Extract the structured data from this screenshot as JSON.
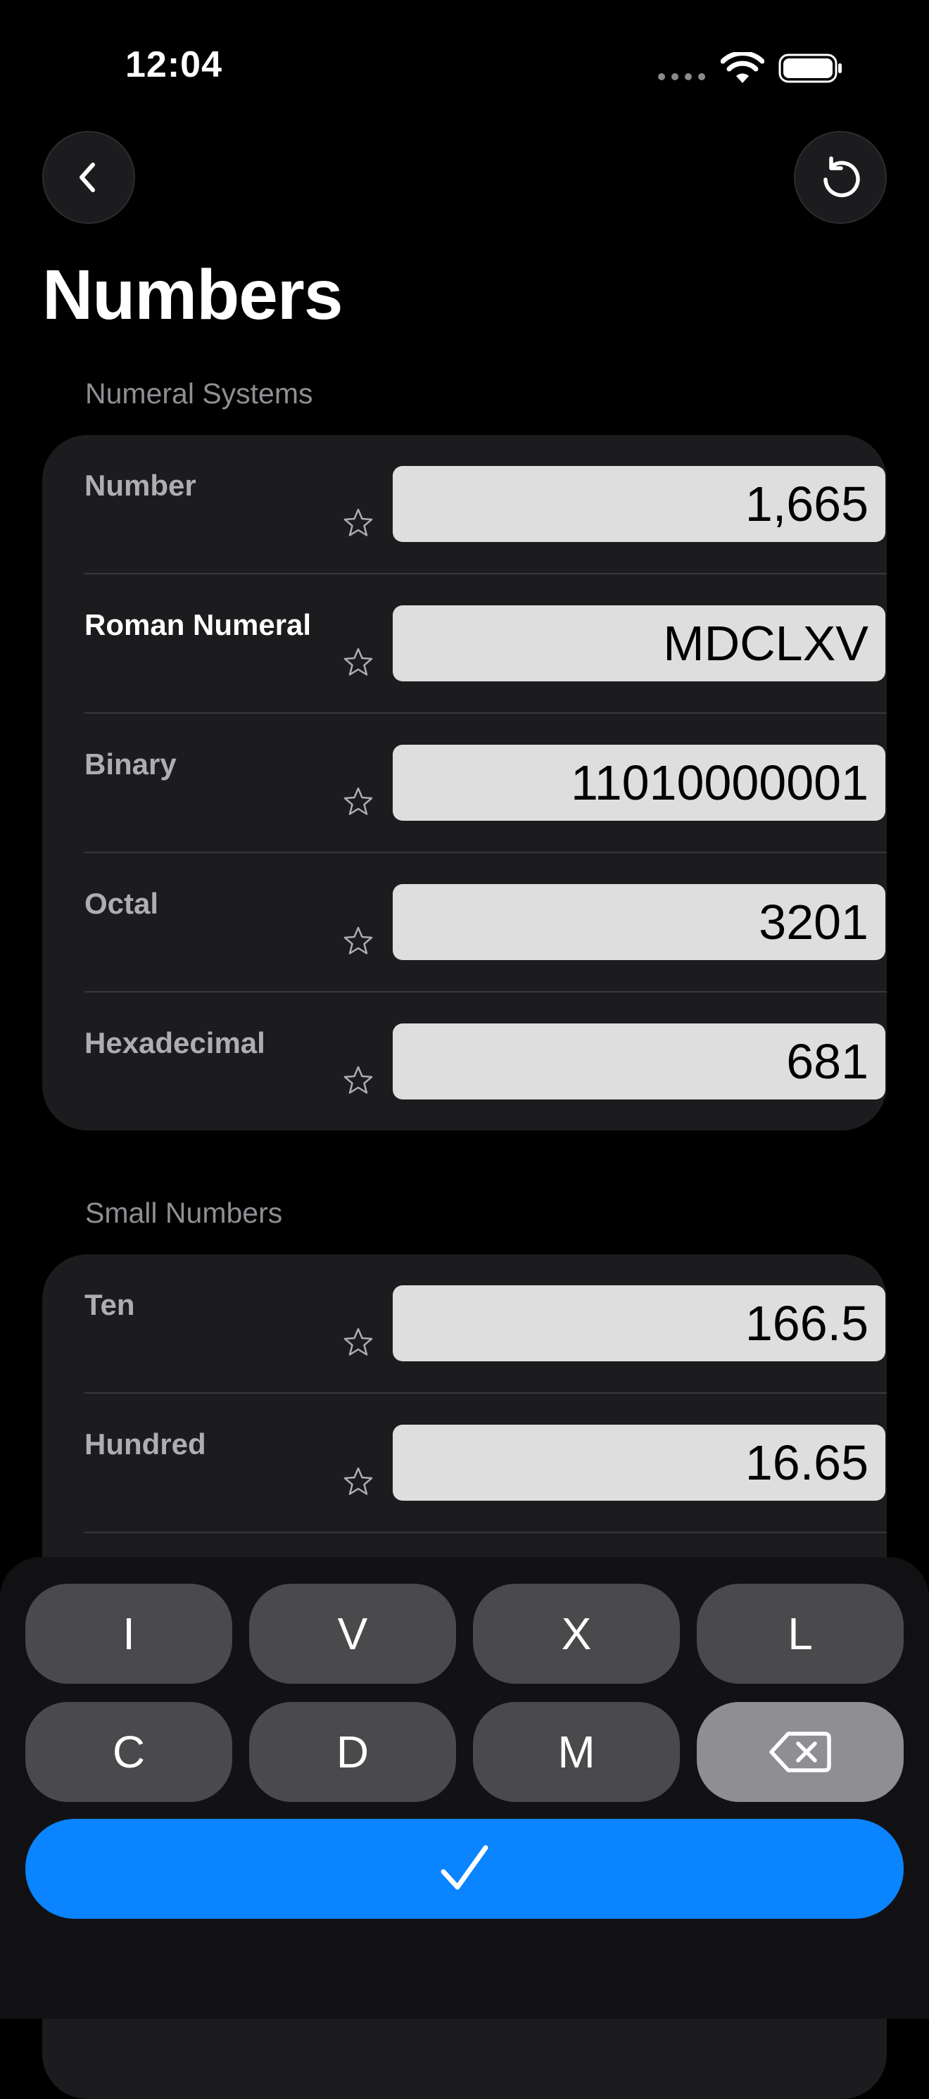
{
  "status_bar": {
    "time": "12:04"
  },
  "title": "Numbers",
  "sections": [
    {
      "header": "Numeral Systems",
      "rows": [
        {
          "label": "Number",
          "value": "1,665"
        },
        {
          "label": "Roman Numeral",
          "value": "MDCLXV",
          "active": true
        },
        {
          "label": "Binary",
          "value": "11010000001"
        },
        {
          "label": "Octal",
          "value": "3201"
        },
        {
          "label": "Hexadecimal",
          "value": "681"
        }
      ]
    },
    {
      "header": "Small Numbers",
      "rows": [
        {
          "label": "Ten",
          "value": "166.5"
        },
        {
          "label": "Hundred",
          "value": "16.65"
        }
      ]
    }
  ],
  "keyboard": {
    "keys_row1": [
      "I",
      "V",
      "X",
      "L"
    ],
    "keys_row2": [
      "C",
      "D",
      "M"
    ],
    "delete_icon": "delete-left-icon",
    "confirm_icon": "checkmark-icon"
  },
  "colors": {
    "background": "#000000",
    "card": "#1c1c1e",
    "field": "#dedede",
    "key": "#4a4a4c",
    "delete_key": "#8e8e93",
    "accent": "#0a84ff"
  }
}
